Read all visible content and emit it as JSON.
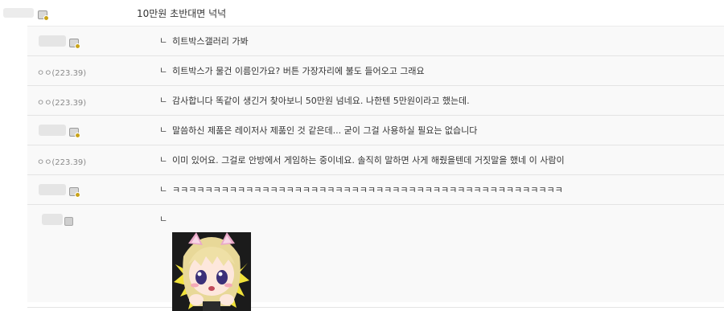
{
  "parent_comment": {
    "text": "10만원 초반대면 넉넉"
  },
  "replies": [
    {
      "ip": "",
      "text": "히트박스갤러리 가봐"
    },
    {
      "ip": "ㅇㅇ(223.39)",
      "text": "히트박스가 물건 이름인가요? 버튼 가장자리에 불도 들어오고 그래요"
    },
    {
      "ip": "ㅇㅇ(223.39)",
      "text": "감사합니다 똑같이 생긴거 찾아보니 50만원 넘네요. 나한텐 5만원이라고 했는데."
    },
    {
      "ip": "",
      "text": "말씀하신 제품은 레이저사 제품인 것 같은데... 굳이 그걸 사용하실 필요는 없습니다"
    },
    {
      "ip": "ㅇㅇ(223.39)",
      "text": "이미 있어요. 그걸로 안방에서 게임하는 중이네요. 솔직히 말하면 사게 해줬을텐데 거짓말을 했네 이 사람이"
    },
    {
      "ip": "",
      "text": "ㅋㅋㅋㅋㅋㅋㅋㅋㅋㅋㅋㅋㅋㅋㅋㅋㅋㅋㅋㅋㅋㅋㅋㅋㅋㅋㅋㅋㅋㅋㅋㅋㅋㅋㅋㅋㅋㅋㅋㅋㅋㅋㅋㅋㅋㅋㅋㅋ"
    }
  ],
  "reply_marker": "ㄴ",
  "icons": {
    "level_badge": "member-level-icon",
    "sticker": "anime-girl-sticker"
  }
}
